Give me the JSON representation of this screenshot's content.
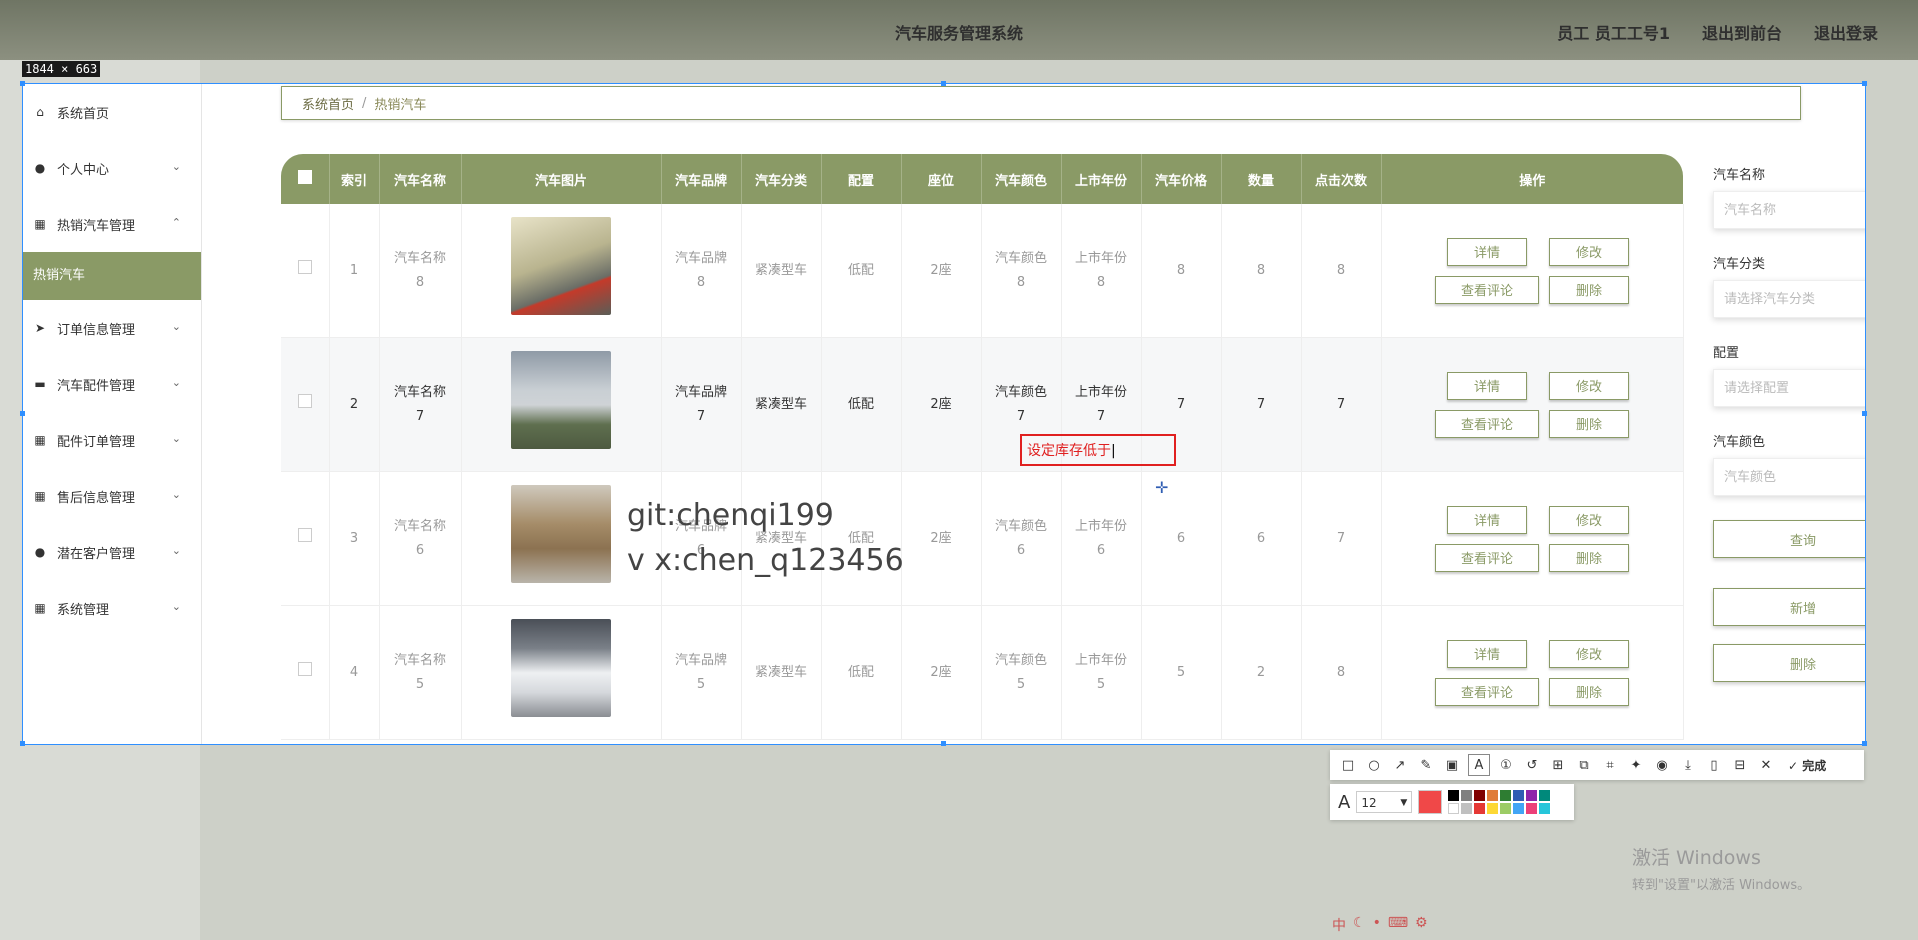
{
  "header": {
    "title": "汽车服务管理系统",
    "user": "员工 员工工号1",
    "to_front": "退出到前台",
    "logout": "退出登录"
  },
  "capture_size": "1844 × 663",
  "sidebar": {
    "items": [
      {
        "label": "系统首页",
        "icon": "home-icon",
        "chevron": ""
      },
      {
        "label": "个人中心",
        "icon": "user-icon",
        "chevron": "⌄"
      },
      {
        "label": "热销汽车管理",
        "icon": "grid-icon",
        "chevron": "⌃"
      },
      {
        "label": "订单信息管理",
        "icon": "send-icon",
        "chevron": "⌄"
      },
      {
        "label": "汽车配件管理",
        "icon": "chat-icon",
        "chevron": "⌄"
      },
      {
        "label": "配件订单管理",
        "icon": "grid-icon",
        "chevron": "⌄"
      },
      {
        "label": "售后信息管理",
        "icon": "grid-icon",
        "chevron": "⌄"
      },
      {
        "label": "潜在客户管理",
        "icon": "user-icon",
        "chevron": "⌄"
      },
      {
        "label": "系统管理",
        "icon": "grid-icon",
        "chevron": "⌄"
      }
    ],
    "active_sub": "热销汽车"
  },
  "breadcrumb": {
    "home": "系统首页",
    "sep": "/",
    "current": "热销汽车"
  },
  "table": {
    "headers": [
      "索引",
      "汽车名称",
      "汽车图片",
      "汽车品牌",
      "汽车分类",
      "配置",
      "座位",
      "汽车颜色",
      "上市年份",
      "汽车价格",
      "数量",
      "点击次数",
      "操作"
    ],
    "rows": [
      {
        "index": "1",
        "name": [
          "汽车名称",
          "8"
        ],
        "brand": [
          "汽车品牌",
          "8"
        ],
        "category": "紧凑型车",
        "config": "低配",
        "seats": "2座",
        "color": [
          "汽车颜色",
          "8"
        ],
        "year": [
          "上市年份",
          "8"
        ],
        "price": "8",
        "qty": "8",
        "clicks": "8"
      },
      {
        "index": "2",
        "name": [
          "汽车名称",
          "7"
        ],
        "brand": [
          "汽车品牌",
          "7"
        ],
        "category": "紧凑型车",
        "config": "低配",
        "seats": "2座",
        "color": [
          "汽车颜色",
          "7"
        ],
        "year": [
          "上市年份",
          "7"
        ],
        "price": "7",
        "qty": "7",
        "clicks": "7"
      },
      {
        "index": "3",
        "name": [
          "汽车名称",
          "6"
        ],
        "brand": [
          "汽车品牌",
          "6"
        ],
        "category": "紧凑型车",
        "config": "低配",
        "seats": "2座",
        "color": [
          "汽车颜色",
          "6"
        ],
        "year": [
          "上市年份",
          "6"
        ],
        "price": "6",
        "qty": "6",
        "clicks": "7"
      },
      {
        "index": "4",
        "name": [
          "汽车名称",
          "5"
        ],
        "brand": [
          "汽车品牌",
          "5"
        ],
        "category": "紧凑型车",
        "config": "低配",
        "seats": "2座",
        "color": [
          "汽车颜色",
          "5"
        ],
        "year": [
          "上市年份",
          "5"
        ],
        "price": "5",
        "qty": "2",
        "clicks": "8"
      }
    ],
    "ops": {
      "detail": "详情",
      "edit": "修改",
      "comments": "查看评论",
      "delete": "删除"
    }
  },
  "search": {
    "name_label": "汽车名称",
    "name_placeholder": "汽车名称",
    "category_label": "汽车分类",
    "category_placeholder": "请选择汽车分类",
    "config_label": "配置",
    "config_placeholder": "请选择配置",
    "color_label": "汽车颜色",
    "color_placeholder": "汽车颜色",
    "query": "查询",
    "add": "新增",
    "delete": "删除"
  },
  "annotation": {
    "text": "设定库存低于"
  },
  "overlay_text": {
    "line1": "git:chenqi199",
    "line2": "v x:chen_q123456"
  },
  "snip_toolbar": {
    "done": "完成",
    "font_size": "12",
    "current_color": "#f04848"
  },
  "windows": {
    "line1": "激活 Windows",
    "line2": "转到\"设置\"以激活 Windows。"
  },
  "colors": {
    "accent": "#8a9a66",
    "annotation": "#e02020",
    "selection": "#2f8fff"
  }
}
